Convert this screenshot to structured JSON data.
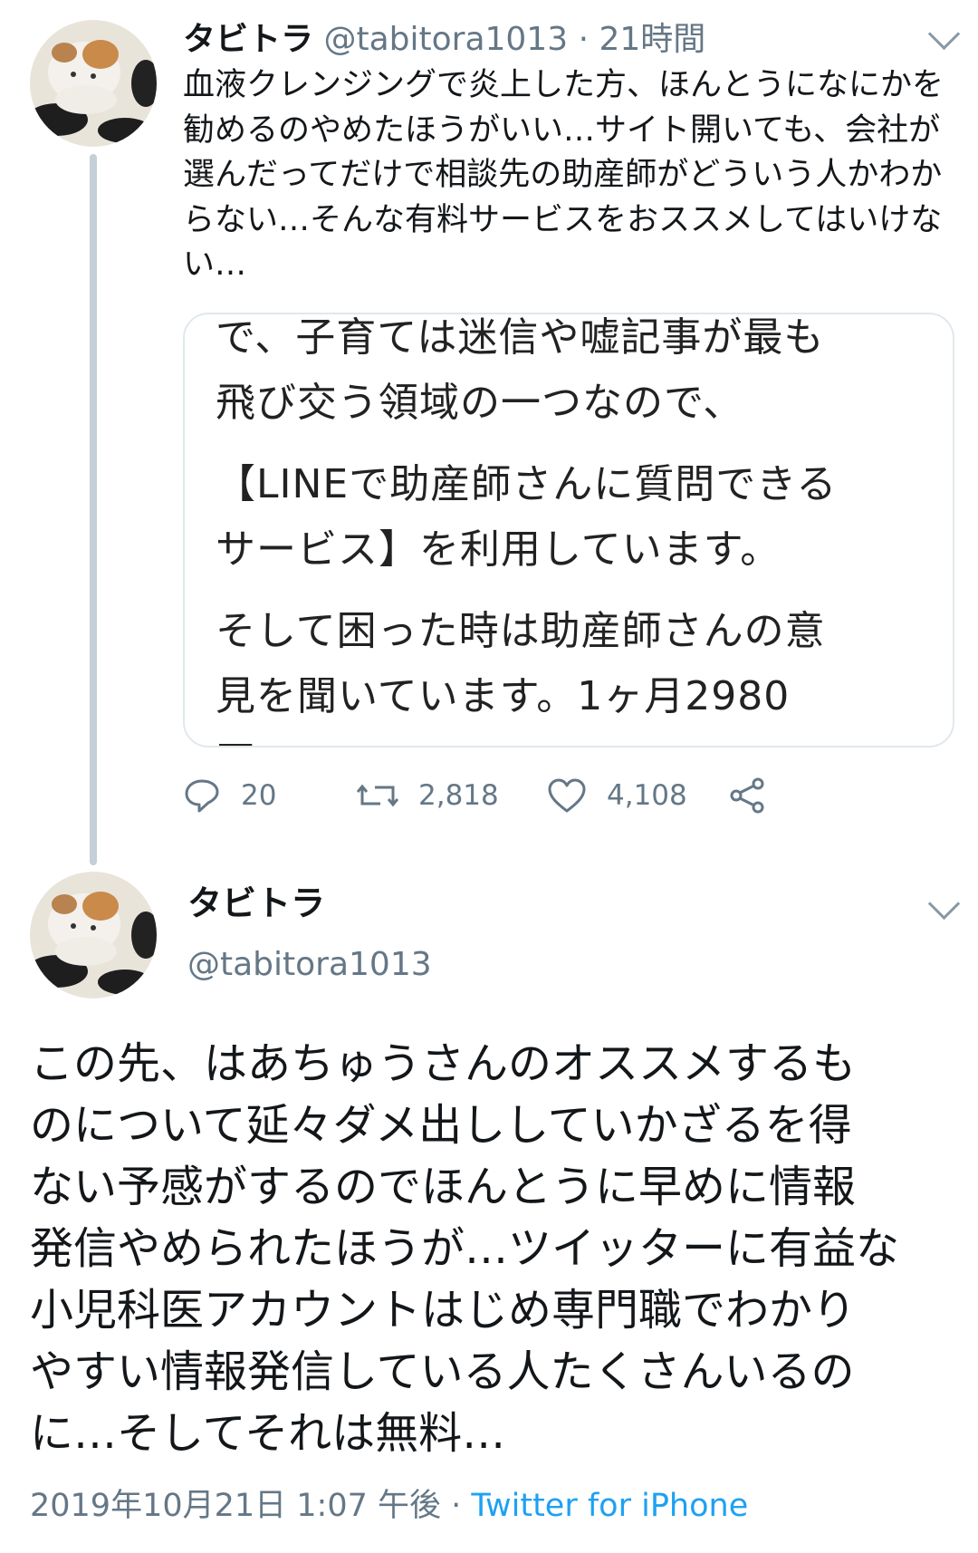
{
  "tweet1": {
    "author_name": "タビトラ",
    "handle": "@tabitora1013",
    "separator": "·",
    "time": "21時間",
    "body_lines": [
      "血液クレンジングで炎上した方、ほんとうになにかを",
      "勧めるのやめたほうがいい…サイト開いても、会社が",
      "選んだってだけで相談先の助産師がどういう人かわか",
      "らない…そんな有料サービスをおススメしてはいけな",
      "い…"
    ],
    "quote": {
      "paragraphs": [
        [
          "で、子育ては迷信や嘘記事が最も",
          "飛び交う領域の一つなので、"
        ],
        [
          "【LINEで助産師さんに質問できる",
          "サービス】を利用しています。"
        ],
        [
          "そして困った時は助産師さんの意",
          "見を聞いています。1ヶ月2980",
          "円"
        ]
      ]
    },
    "actions": {
      "replies": "20",
      "retweets": "2,818",
      "likes": "4,108"
    }
  },
  "tweet2": {
    "author_name": "タビトラ",
    "handle": "@tabitora1013",
    "body_lines": [
      "この先、はあちゅうさんのオススメするも",
      "のについて延々ダメ出ししていかざるを得",
      "ない予感がするのでほんとうに早めに情報",
      "発信やめられたほうが…ツイッターに有益な",
      "小児科医アカウントはじめ専門職でわかり",
      "やすい情報発信している人たくさんいるの",
      "に…そしてそれは無料…"
    ],
    "timestamp": "2019年10月21日 1:07 午後",
    "separator": "·",
    "client": "Twitter for iPhone"
  },
  "colors": {
    "text_primary": "#14171a",
    "text_secondary": "#657786",
    "link": "#1da1f2",
    "border": "#e1e8ed",
    "thread_line": "#c4cfd6"
  },
  "icons": [
    "reply-icon",
    "retweet-icon",
    "like-icon",
    "share-icon",
    "chevron-down-icon"
  ]
}
